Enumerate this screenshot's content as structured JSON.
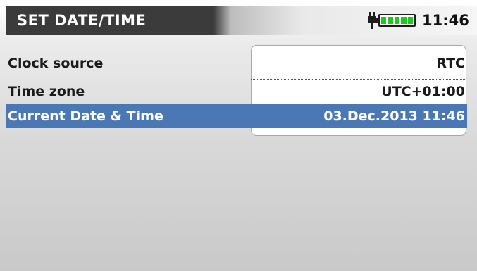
{
  "header": {
    "title": "SET DATE/TIME",
    "clock": "11:46",
    "battery_level": 1.0,
    "icons": [
      "plug-icon",
      "battery-icon"
    ]
  },
  "settings": [
    {
      "label": "Clock source",
      "value": "RTC"
    },
    {
      "label": "Time zone",
      "value": "UTC+01:00"
    },
    {
      "label": "Current Date & Time",
      "value": "03.Dec.2013 11:46",
      "selected": true
    }
  ],
  "colors": {
    "header_bg": "#3b3b3b",
    "selected_bg": "#4b78b4",
    "battery_fill": "#1fc81f"
  }
}
